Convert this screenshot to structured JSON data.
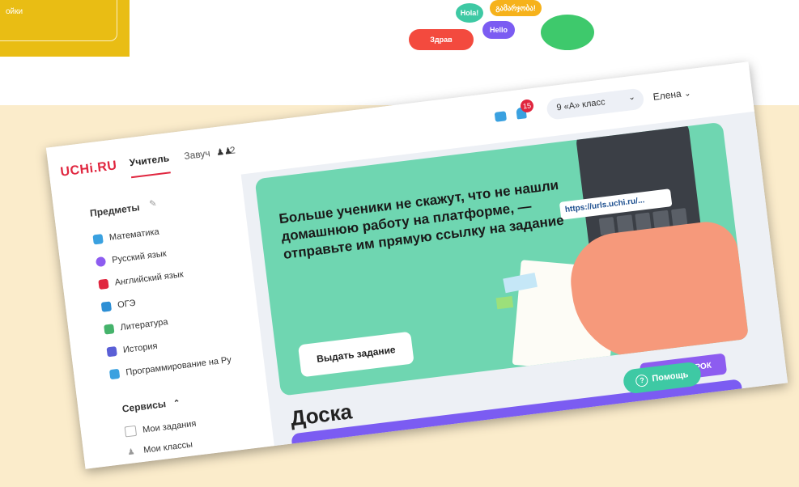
{
  "background_colors": {
    "page": "#fdf3dc",
    "yellow": "#e9bd14",
    "banner": "#6fd6b1",
    "accent": "#8d5cf0",
    "logo": "#e0263f"
  },
  "top_yellow_text": "ойки",
  "bubbles": {
    "hola": "Hola!",
    "georgian": "გამარჯობა!",
    "partial": "Здрав",
    "partial2": "Hello"
  },
  "header": {
    "logo": "UCHi.RU",
    "tab_teacher": "Учитель",
    "tab_zavuch": "Завуч",
    "zavuch_count": "2",
    "notification_count": "15",
    "class_selector": "9 «А» класс",
    "user_name": "Елена"
  },
  "sidebar": {
    "subjects_title": "Предметы",
    "subjects": [
      {
        "label": "Математика",
        "color": "#3aa1e0"
      },
      {
        "label": "Русский язык",
        "color": "#8d5cf0"
      },
      {
        "label": "Английский язык",
        "color": "#e0263f"
      },
      {
        "label": "ОГЭ",
        "color": "#2d8fd5"
      },
      {
        "label": "Литература",
        "color": "#45b36b"
      },
      {
        "label": "История",
        "color": "#5a5fd6"
      },
      {
        "label": "Программирование на Ру",
        "color": "#3aa1e0"
      }
    ],
    "services_title": "Сервисы",
    "services": [
      "Мои задания",
      "Мои классы"
    ]
  },
  "banner": {
    "text": "Больше ученики не скажут, что не нашли домашнюю работу на платформе, — отправьте им прямую ссылку на задание",
    "button": "Выдать задание",
    "url": "https://urls.uchi.ru/..."
  },
  "start_lesson": "НАЧАТЬ УРОК",
  "board_title": "Доска",
  "help": "Помощь"
}
